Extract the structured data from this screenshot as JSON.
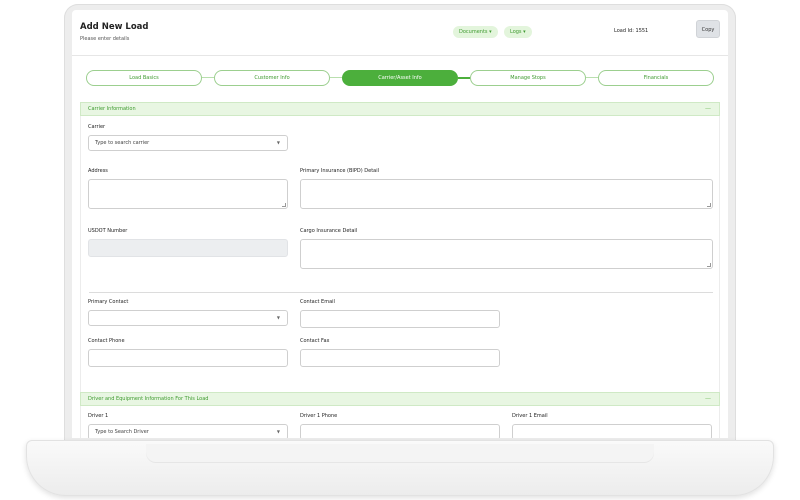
{
  "header": {
    "title": "Add New Load",
    "subtitle": "Please enter details",
    "documents_label": "Documents ▾",
    "logs_label": "Logs ▾",
    "load_id": "Load Id: 1551",
    "copy_label": "Copy"
  },
  "stepper": {
    "steps": [
      {
        "label": "Load Basics"
      },
      {
        "label": "Customer Info"
      },
      {
        "label": "Carrier/Asset Info"
      },
      {
        "label": "Manage Stops"
      },
      {
        "label": "Financials"
      }
    ],
    "active_index": 2
  },
  "carrier_section": {
    "title": "Carrier Information",
    "collapse": "—",
    "carrier_label": "Carrier",
    "carrier_placeholder": "Type to search carrier",
    "address_label": "Address",
    "primary_insurance_label": "Primary Insurance (BIPD) Detail",
    "usdot_label": "USDOT Number",
    "cargo_insurance_label": "Cargo Insurance Detail",
    "primary_contact_label": "Primary Contact",
    "contact_email_label": "Contact Email",
    "contact_phone_label": "Contact Phone",
    "contact_fax_label": "Contact Fax"
  },
  "driver_section": {
    "title": "Driver and Equipment Information For This Load",
    "collapse": "—",
    "driver1_label": "Driver 1",
    "driver1_placeholder": "Type to Search Driver",
    "driver1_phone_label": "Driver 1 Phone",
    "driver1_email_label": "Driver 1 Email"
  },
  "colors": {
    "accent": "#4caf3c",
    "accent_light": "#e8f6e2",
    "accent_text": "#3e9a2f"
  }
}
